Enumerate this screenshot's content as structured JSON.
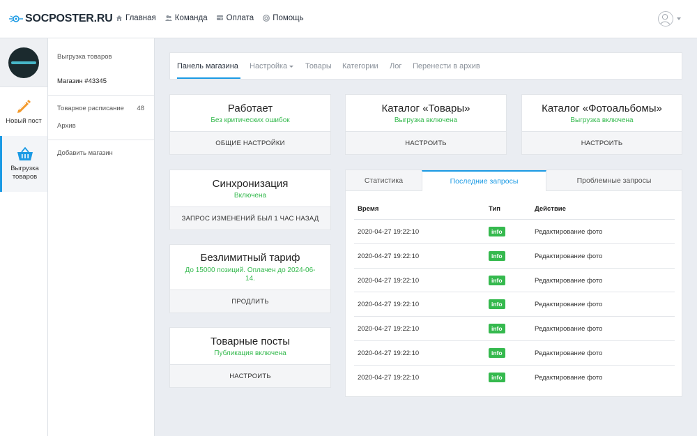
{
  "brand": {
    "name": "SOCPOSTER.RU",
    "accent": "#1b9ae4",
    "green": "#35b94e"
  },
  "topnav": [
    {
      "label": "Главная",
      "icon": "home-icon"
    },
    {
      "label": "Команда",
      "icon": "users-icon"
    },
    {
      "label": "Оплата",
      "icon": "payment-icon"
    },
    {
      "label": "Помощь",
      "icon": "help-icon"
    }
  ],
  "iconbar": {
    "new_post": "Новый пост",
    "export_line1": "Выгрузка",
    "export_line2": "товаров"
  },
  "sidebar": {
    "title": "Выгрузка товаров",
    "shop": "Магазин #43345",
    "schedule": "Товарное расписание",
    "schedule_count": "48",
    "archive": "Архив",
    "add_shop": "Добавить магазин"
  },
  "tabs": {
    "panel": "Панель магазина",
    "settings": "Настройка",
    "goods": "Товары",
    "categories": "Категории",
    "log": "Лог",
    "archive": "Перенести в архив"
  },
  "cards": {
    "status": {
      "title": "Работает",
      "sub": "Без критических ошибок",
      "button": "ОБЩИЕ НАСТРОЙКИ"
    },
    "sync": {
      "title": "Синхронизация",
      "sub": "Включена",
      "button": "ЗАПРОС ИЗМЕНЕНИЙ БЫЛ 1 ЧАС НАЗАД"
    },
    "tariff": {
      "title": "Безлимитный тариф",
      "sub": "До 15000 позиций. Оплачен до 2024-06-14.",
      "button": "ПРОДЛИТЬ"
    },
    "posts": {
      "title": "Товарные посты",
      "sub": "Публикация включена",
      "button": "НАСТРОИТЬ"
    },
    "catalog_goods": {
      "title": "Каталог «Товары»",
      "sub": "Выгрузка включена",
      "button": "НАСТРОИТЬ"
    },
    "catalog_albums": {
      "title": "Каталог «Фотоальбомы»",
      "sub": "Выгрузка включена",
      "button": "НАСТРОИТЬ"
    }
  },
  "requests": {
    "tabs": {
      "stats": "Статистика",
      "recent": "Последние запросы",
      "problem": "Проблемные запросы"
    },
    "headers": {
      "time": "Время",
      "type": "Тип",
      "action": "Действие"
    },
    "rows": [
      {
        "time": "2020-04-27 19:22:10",
        "type": "info",
        "action": "Редактирование фото"
      },
      {
        "time": "2020-04-27 19:22:10",
        "type": "info",
        "action": "Редактирование фото"
      },
      {
        "time": "2020-04-27 19:22:10",
        "type": "info",
        "action": "Редактирование фото"
      },
      {
        "time": "2020-04-27 19:22:10",
        "type": "info",
        "action": "Редактирование фото"
      },
      {
        "time": "2020-04-27 19:22:10",
        "type": "info",
        "action": "Редактирование фото"
      },
      {
        "time": "2020-04-27 19:22:10",
        "type": "info",
        "action": "Редактирование фото"
      },
      {
        "time": "2020-04-27 19:22:10",
        "type": "info",
        "action": "Редактирование фото"
      }
    ]
  }
}
